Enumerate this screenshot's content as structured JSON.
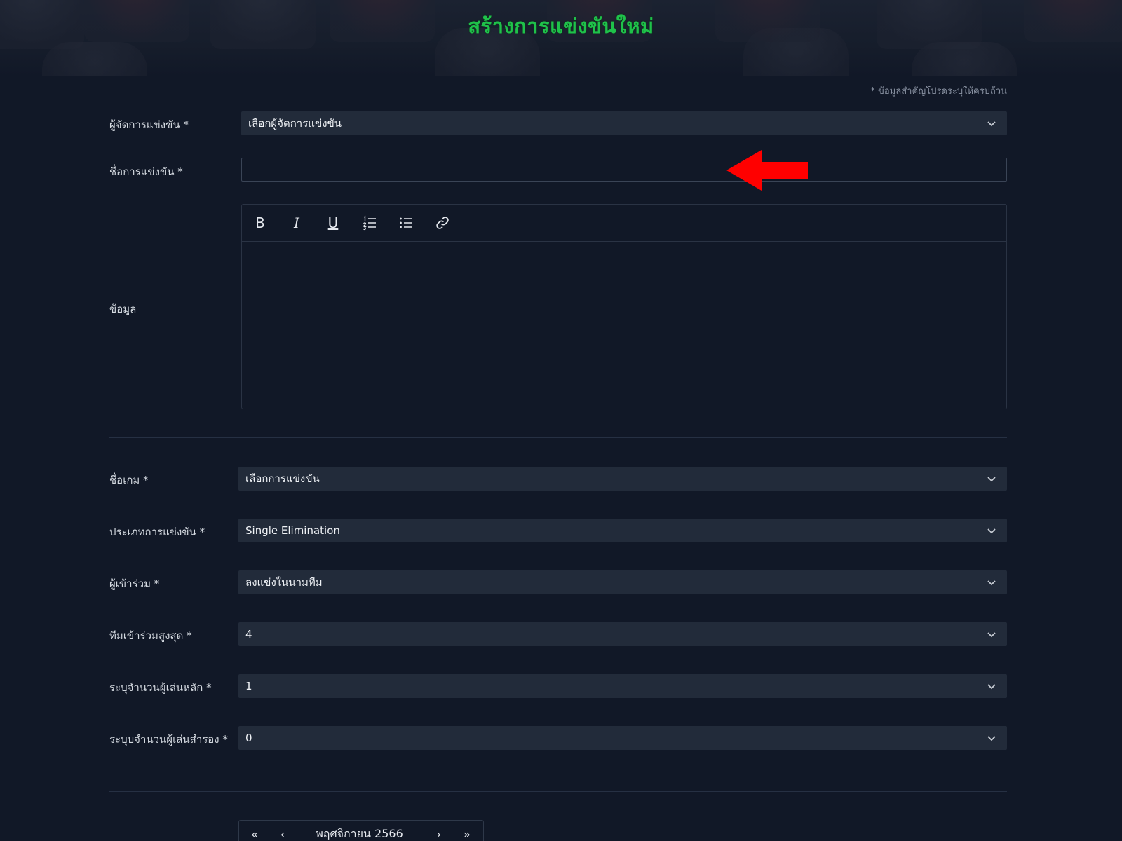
{
  "page": {
    "title": "สร้างการแข่งขันใหม่",
    "required_note": "* ข้อมูลสำคัญโปรดระบุให้ครบถ้วน"
  },
  "form": {
    "organizer": {
      "label": "ผู้จัดการแข่งขัน *",
      "value": "เลือกผู้จัดการแข่งขัน"
    },
    "name": {
      "label": "ชื่อการแข่งขัน *",
      "value": ""
    },
    "info": {
      "label": "ข้อมูล"
    },
    "game": {
      "label": "ชื่อเกม *",
      "value": "เลือกการแข่งขัน"
    },
    "type": {
      "label": "ประเภทการแข่งขัน *",
      "value": "Single Elimination"
    },
    "participants": {
      "label": "ผู้เข้าร่วม *",
      "value": "ลงแข่งในนามทีม"
    },
    "max_teams": {
      "label": "ทีมเข้าร่วมสูงสุด *",
      "value": "4"
    },
    "main_players": {
      "label": "ระบุจำนวนผู้เล่นหลัก *",
      "value": "1"
    },
    "sub_players": {
      "label": "ระบุบจำนวนผู้เล่นสำรอง *",
      "value": "0"
    }
  },
  "editor_toolbar": {
    "bold": "B",
    "italic": "I",
    "underline": "U",
    "icons": [
      "bold-icon",
      "italic-icon",
      "underline-icon",
      "ordered-list-icon",
      "bullet-list-icon",
      "link-icon"
    ]
  },
  "calendar": {
    "prev_year": "«",
    "prev_month": "‹",
    "month_label": "พฤศจิกายน 2566",
    "next_month": "›",
    "next_year": "»"
  },
  "colors": {
    "background": "#111827",
    "field_bg": "#222b3a",
    "title_green": "#1fc24a",
    "arrow_red": "#ff0000"
  }
}
